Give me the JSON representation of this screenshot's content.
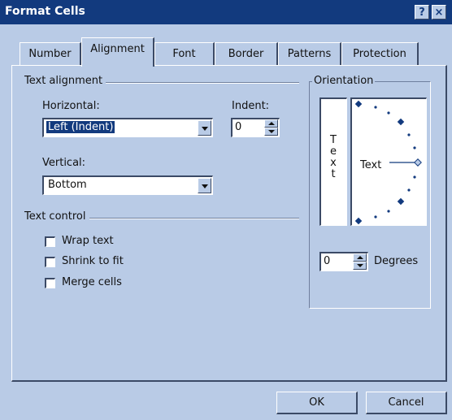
{
  "window": {
    "title": "Format Cells",
    "help_label": "?",
    "close_label": "×"
  },
  "tabs": [
    {
      "label": "Number"
    },
    {
      "label": "Alignment",
      "active": true
    },
    {
      "label": "Font"
    },
    {
      "label": "Border"
    },
    {
      "label": "Patterns"
    },
    {
      "label": "Protection"
    }
  ],
  "alignment": {
    "group_title": "Text alignment",
    "horizontal_label": "Horizontal:",
    "horizontal_value": "Left (Indent)",
    "indent_label": "Indent:",
    "indent_value": "0",
    "vertical_label": "Vertical:",
    "vertical_value": "Bottom"
  },
  "text_control": {
    "group_title": "Text control",
    "wrap_text": {
      "label": "Wrap text",
      "checked": false
    },
    "shrink_to_fit": {
      "label": "Shrink to fit",
      "checked": false
    },
    "merge_cells": {
      "label": "Merge cells",
      "checked": false
    }
  },
  "orientation": {
    "group_title": "Orientation",
    "vertical_letters": [
      "T",
      "e",
      "x",
      "t"
    ],
    "dial_label": "Text",
    "degrees_value": "0",
    "degrees_label": "Degrees"
  },
  "buttons": {
    "ok_label": "OK",
    "cancel_label": "Cancel"
  },
  "colors": {
    "titlebar": "#123a7e",
    "dialog_face": "#b9cbe6",
    "selection": "#123a7e"
  }
}
